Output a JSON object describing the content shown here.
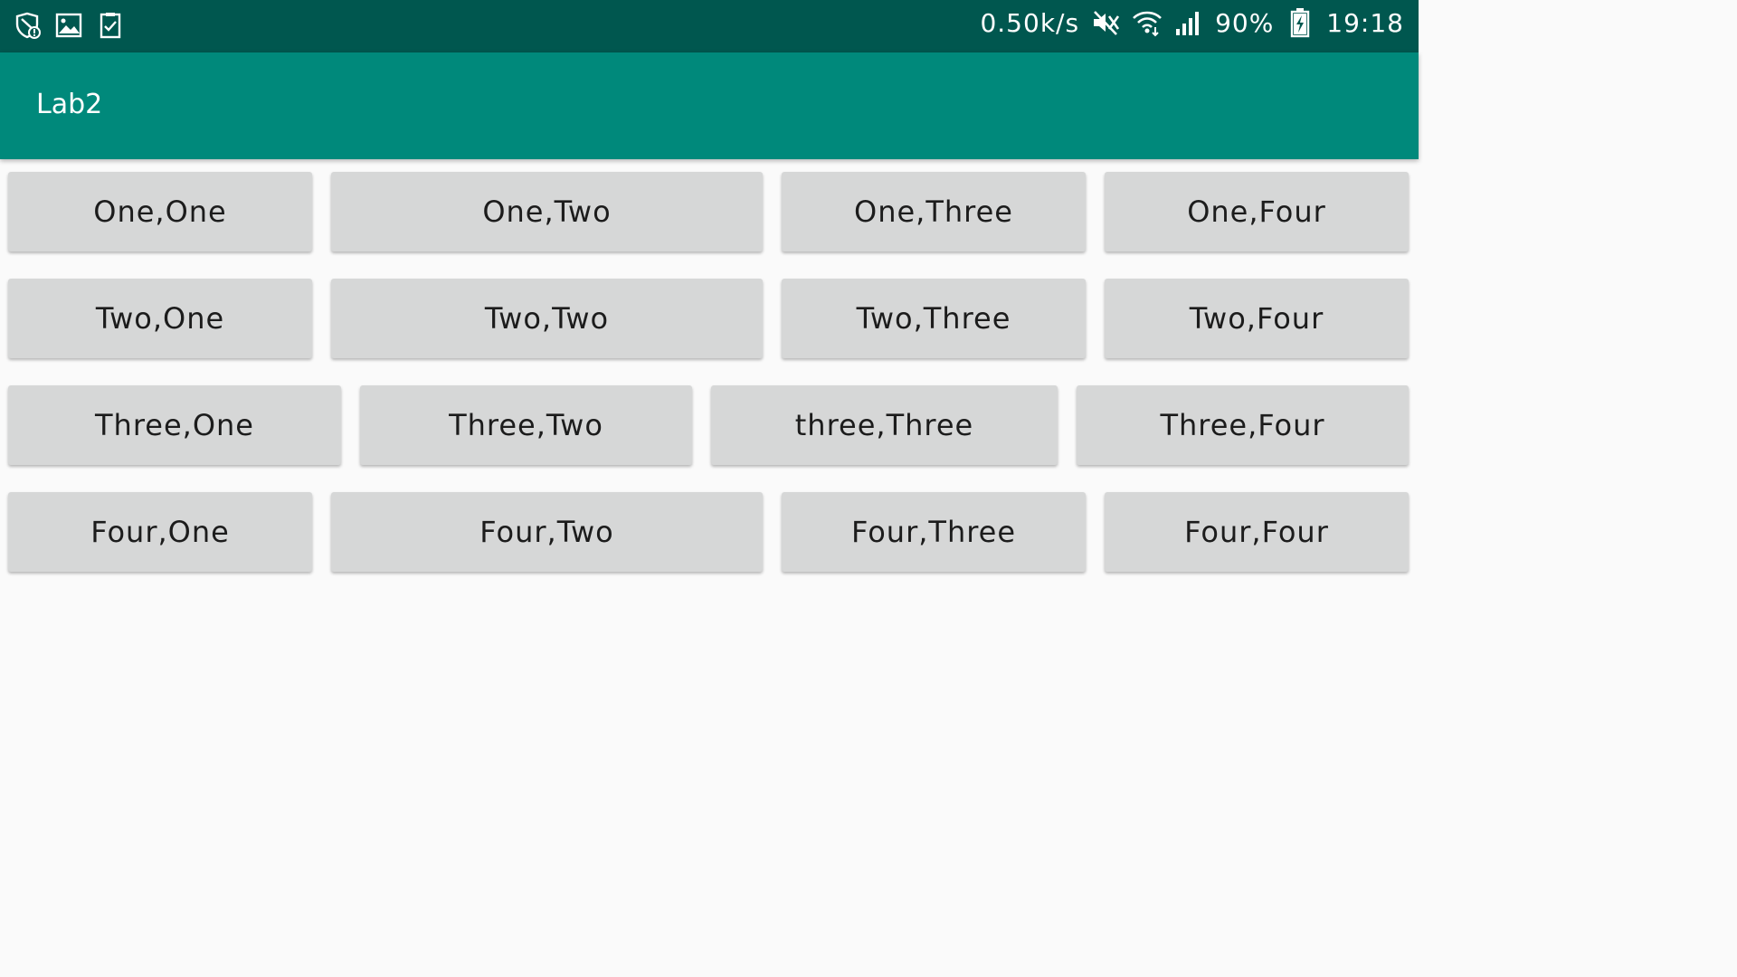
{
  "status_bar": {
    "left_icons": [
      "shield-alert-icon",
      "image-icon",
      "checkbox-icon"
    ],
    "speed": "0.50k/s",
    "battery_percent": "90%",
    "time": "19:18",
    "right_icons": [
      "mute-icon",
      "wifi-icon",
      "signal-icon",
      "battery-charging-icon"
    ]
  },
  "app_bar": {
    "title": "Lab2"
  },
  "colors": {
    "status_bar": "#00574f",
    "app_bar": "#00897b",
    "button": "#d6d7d7",
    "background": "#fafafa"
  },
  "grid": {
    "rows": [
      [
        "One,One",
        "One,Two",
        "One,Three",
        "One,Four"
      ],
      [
        "Two,One",
        "Two,Two",
        "Two,Three",
        "Two,Four"
      ],
      [
        "Three,One",
        "Three,Two",
        "three,Three",
        "Three,Four"
      ],
      [
        "Four,One",
        "Four,Two",
        "Four,Three",
        "Four,Four"
      ]
    ]
  }
}
